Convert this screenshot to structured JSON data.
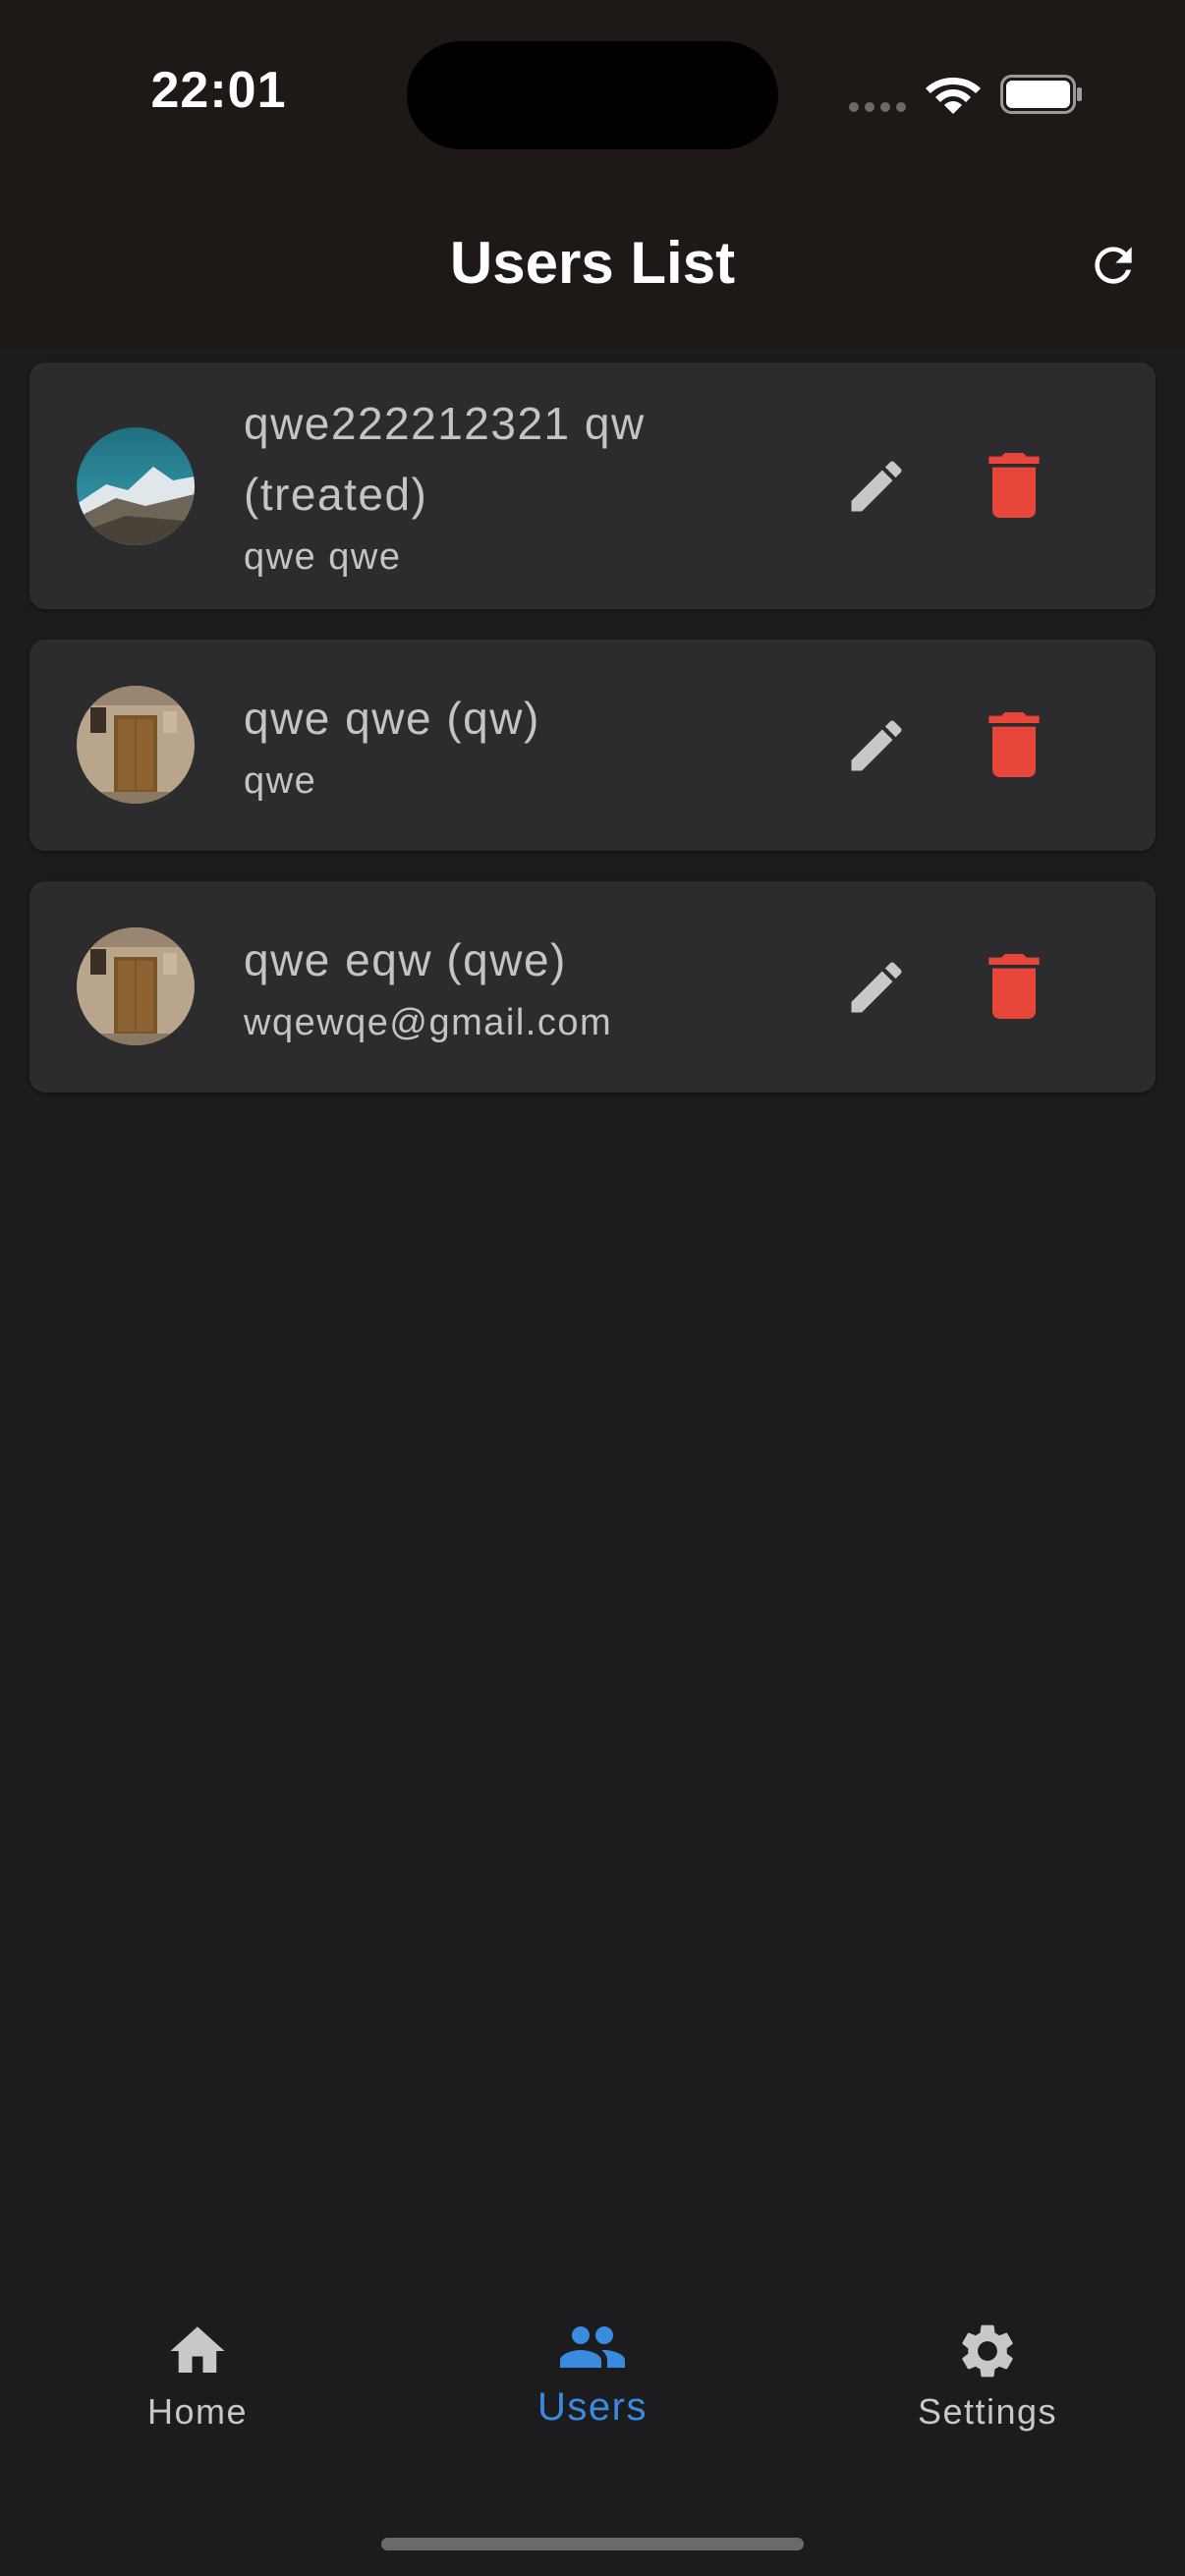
{
  "status_bar": {
    "time": "22:01"
  },
  "app_bar": {
    "title": "Users List",
    "action_icon": "refresh-icon"
  },
  "users": [
    {
      "name": "qwe222212321 qw (treated)",
      "subtitle": "qwe qwe",
      "avatar": "mountain-photo"
    },
    {
      "name": "qwe qwe (qw)",
      "subtitle": "qwe",
      "avatar": "door-photo"
    },
    {
      "name": "qwe eqw (qwe)",
      "subtitle": "wqewqe@gmail.com",
      "avatar": "door-photo"
    }
  ],
  "bottom_nav": {
    "items": [
      {
        "label": "Home",
        "icon": "home-icon",
        "active": false
      },
      {
        "label": "Users",
        "icon": "people-icon",
        "active": true
      },
      {
        "label": "Settings",
        "icon": "gear-icon",
        "active": false
      }
    ]
  },
  "colors": {
    "background": "#1c1c1e",
    "card": "#2c2c2e",
    "topbar": "#1e1816",
    "text_secondary": "#c4c4c6",
    "accent": "#3a8be0",
    "delete": "#e8463a",
    "inactive_icon": "#c8c8ca"
  }
}
